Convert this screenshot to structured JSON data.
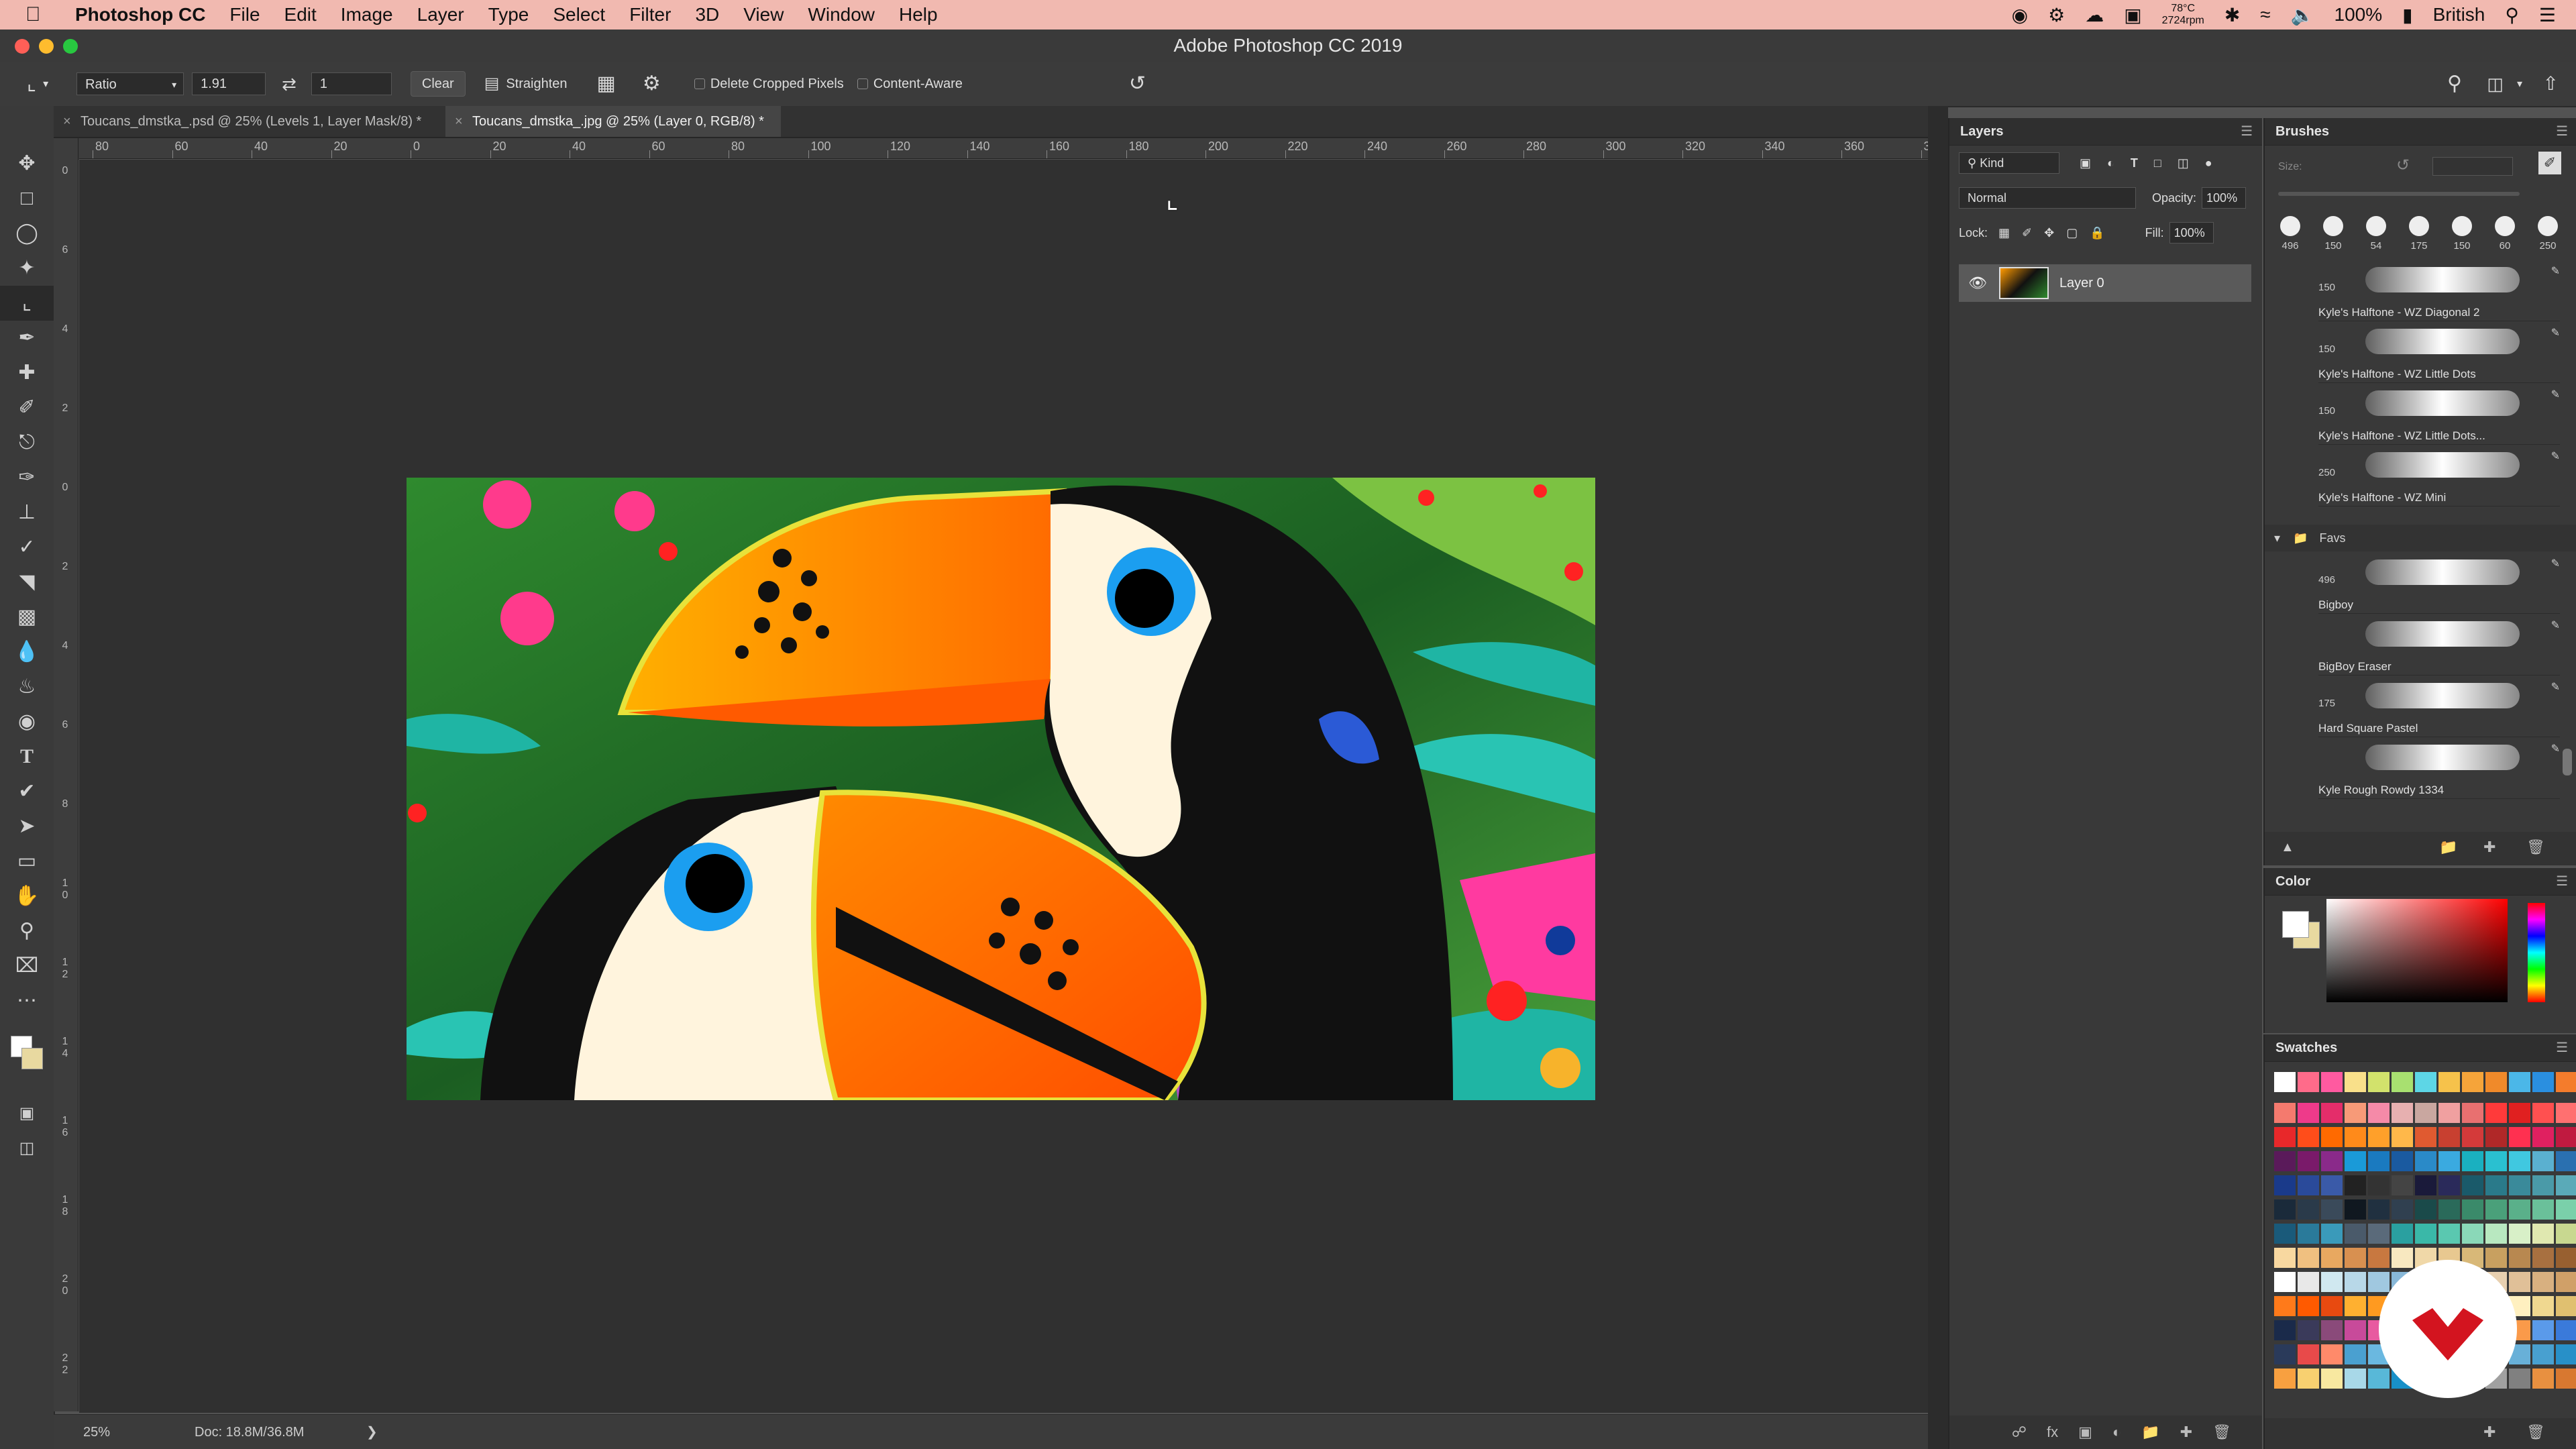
{
  "menubar": {
    "app_name": "Photoshop CC",
    "items": [
      "File",
      "Edit",
      "Image",
      "Layer",
      "Type",
      "Select",
      "Filter",
      "3D",
      "View",
      "Window",
      "Help"
    ],
    "temp": "78°C",
    "rpm": "2724rpm",
    "battery": "100%",
    "input_source": "British"
  },
  "window": {
    "title": "Adobe Photoshop CC 2019"
  },
  "options": {
    "ratio_label": "Ratio",
    "width_value": "1.91",
    "height_value": "1",
    "clear_label": "Clear",
    "straighten_label": "Straighten",
    "delete_cropped_label": "Delete Cropped Pixels",
    "content_aware_label": "Content-Aware"
  },
  "tabs": [
    {
      "label": "Toucans_dmstka_.psd @ 25% (Levels 1, Layer Mask/8) *"
    },
    {
      "label": "Toucans_dmstka_.jpg @ 25% (Layer 0, RGB/8) *"
    }
  ],
  "ruler": {
    "h_ticks": [
      "80",
      "60",
      "40",
      "20",
      "0",
      "20",
      "40",
      "60",
      "80",
      "100",
      "120",
      "140",
      "160",
      "180",
      "200",
      "220",
      "240",
      "260",
      "280",
      "300",
      "320",
      "340",
      "360",
      "3"
    ],
    "v_ticks": [
      "0",
      "6",
      "4",
      "2",
      "0",
      "2",
      "4",
      "6",
      "8",
      "1\n0",
      "1\n2",
      "1\n4",
      "1\n6",
      "1\n8",
      "2\n0",
      "2\n2"
    ]
  },
  "status": {
    "zoom": "25%",
    "doc": "Doc: 18.8M/36.8M"
  },
  "layers_panel": {
    "title": "Layers",
    "kind_label": "Kind",
    "blend_mode": "Normal",
    "opacity_label": "Opacity:",
    "opacity_value": "100%",
    "lock_label": "Lock:",
    "fill_label": "Fill:",
    "fill_value": "100%",
    "layer_name": "Layer 0"
  },
  "brushes_panel": {
    "title": "Brushes",
    "size_label": "Size:",
    "tip_sizes": [
      "496",
      "150",
      "54",
      "175",
      "150",
      "60",
      "250"
    ],
    "brushes": [
      {
        "size": "150",
        "name": "Kyle's Halftone - WZ Diagonal 2"
      },
      {
        "size": "150",
        "name": "Kyle's Halftone - WZ Little Dots"
      },
      {
        "size": "150",
        "name": "Kyle's Halftone - WZ Little Dots..."
      },
      {
        "size": "250",
        "name": "Kyle's Halftone - WZ Mini"
      }
    ],
    "group_name": "Favs",
    "fav_brushes": [
      {
        "size": "496",
        "name": "Bigboy"
      },
      {
        "size": "",
        "name": "BigBoy Eraser"
      },
      {
        "size": "175",
        "name": "Hard Square Pastel"
      },
      {
        "size": "",
        "name": "Kyle Rough Rowdy 1334"
      }
    ]
  },
  "color_panel": {
    "title": "Color",
    "foreground": "#ffffff",
    "background": "#e8d9a0"
  },
  "swatches_panel": {
    "title": "Swatches"
  }
}
